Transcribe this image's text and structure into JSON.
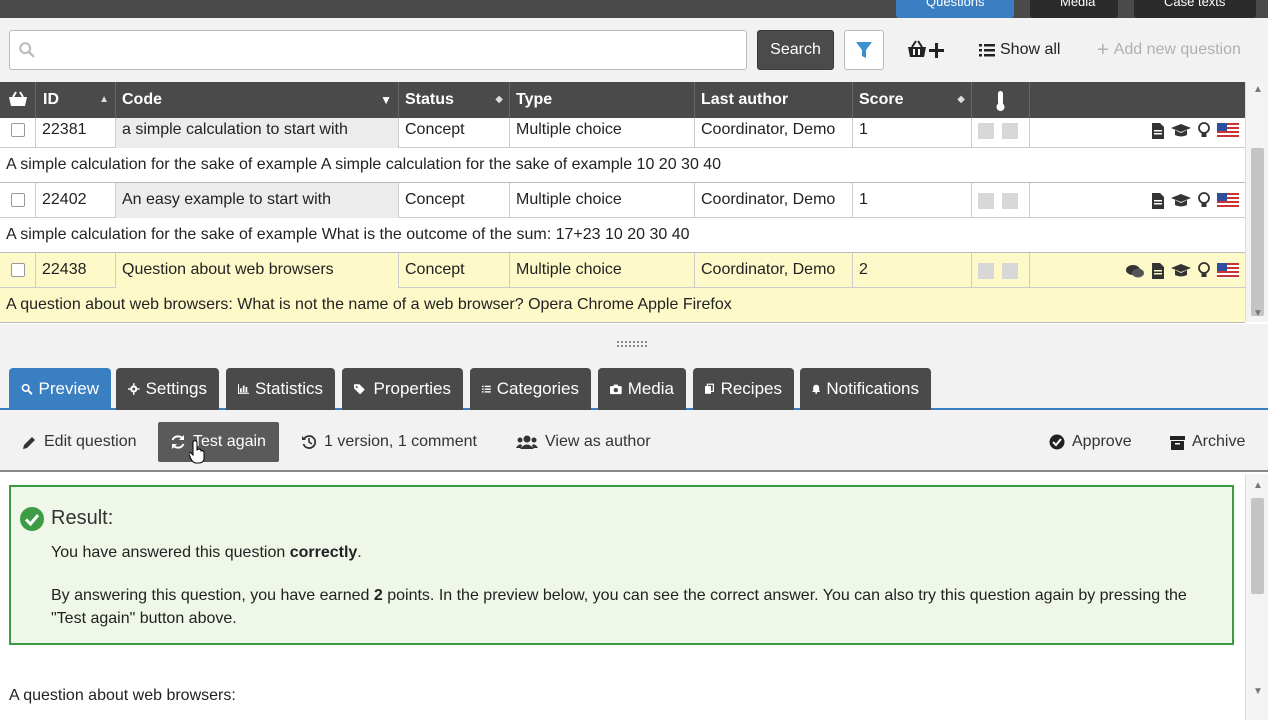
{
  "top_tabs": [
    "Questions",
    "Media",
    "Case texts"
  ],
  "search": {
    "placeholder": "",
    "button": "Search",
    "show_all": "Show all",
    "add_new": "Add new question"
  },
  "table": {
    "headers": [
      "ID",
      "Code",
      "Status",
      "Type",
      "Last author",
      "Score"
    ],
    "rows": [
      {
        "id": "22381",
        "code": "a simple calculation to start with",
        "status": "Concept",
        "type": "Multiple choice",
        "author": "Coordinator, Demo",
        "score": "1",
        "description": "A simple calculation for the sake of example A simple calculation for the sake of example 10 20 30 40",
        "highlighted": false,
        "comment_icon": false
      },
      {
        "id": "22402",
        "code": "An easy example to start with",
        "status": "Concept",
        "type": "Multiple choice",
        "author": "Coordinator, Demo",
        "score": "1",
        "description": "A simple calculation for the sake of example What is the outcome of the sum: 17+23 10 20 30 40",
        "highlighted": false,
        "comment_icon": false
      },
      {
        "id": "22438",
        "code": "Question about web browsers",
        "status": "Concept",
        "type": "Multiple choice",
        "author": "Coordinator, Demo",
        "score": "2",
        "description": "A question about web browsers: What is not the name of a web browser? Opera Chrome Apple Firefox",
        "highlighted": true,
        "comment_icon": true
      }
    ]
  },
  "tabs": [
    "Preview",
    "Settings",
    "Statistics",
    "Properties",
    "Categories",
    "Media",
    "Recipes",
    "Notifications"
  ],
  "toolbar": {
    "edit": "Edit question",
    "test_again": "Test again",
    "versions": "1 version, 1 comment",
    "view_as_author": "View as author",
    "approve": "Approve",
    "archive": "Archive"
  },
  "result": {
    "title": "Result:",
    "line1_prefix": "You have answered this question ",
    "line1_bold": "correctly",
    "line1_suffix": ".",
    "line2_prefix": "By answering this question, you have earned ",
    "line2_bold": "2",
    "line2_suffix": " points. In the preview below, you can see the correct answer. You can also try this question again by pressing the \"Test again\" button above."
  },
  "question_intro": "A question about web browsers:",
  "colors": {
    "accent": "#3a7fc2",
    "dark": "#4a4a4a",
    "success": "#3d9b45",
    "highlight": "#fdf9c8"
  }
}
